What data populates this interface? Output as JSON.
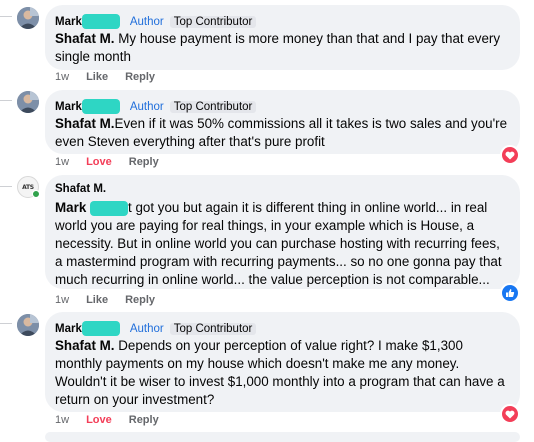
{
  "comments": [
    {
      "author": "Mark",
      "author_tag": "Author",
      "badge": "Top Contributor",
      "mention": "Shafat M.",
      "text": " My house payment is more money than that and I pay that every single month",
      "time": "1w",
      "reaction": "Like",
      "reply": "Reply",
      "reaction_icon": ""
    },
    {
      "author": "Mark",
      "author_tag": "Author",
      "badge": "Top Contributor",
      "mention": "Shafat M.",
      "text": "Even if it was 50% commissions all it takes is two sales and you're even Steven everything after that's pure profit",
      "time": "1w",
      "reaction": "Love",
      "reply": "Reply",
      "reaction_icon": "heart-icon"
    },
    {
      "author": "Shafat M.",
      "avatar_text": "ATS",
      "mention": "Mark",
      "text": "t got you but again it is different thing in online world... in real world you are paying for real things, in your example which is House, a necessity. But in online world you can purchase hosting with recurring fees, a mastermind program with recurring payments... so no one gonna pay that much recurring in online world... the value perception is not comparable...",
      "time": "1w",
      "reaction": "Like",
      "reply": "Reply",
      "reaction_icon": "thumbs-up-icon"
    },
    {
      "author": "Mark",
      "author_tag": "Author",
      "badge": "Top Contributor",
      "mention": "Shafat M.",
      "text": " Depends on your perception of value right? I make $1,300 monthly payments on my house which doesn't make me any money. Wouldn't it be wiser to invest $1,000 monthly into a program that can have a return on your investment?",
      "time": "1w",
      "reaction": "Love",
      "reply": "Reply",
      "reaction_icon": "heart-icon"
    }
  ],
  "colors": {
    "bubble": "#f0f2f5",
    "link": "#216fdb",
    "love": "#f33e58",
    "like": "#1877f2",
    "redaction": "#2ed6c4"
  }
}
